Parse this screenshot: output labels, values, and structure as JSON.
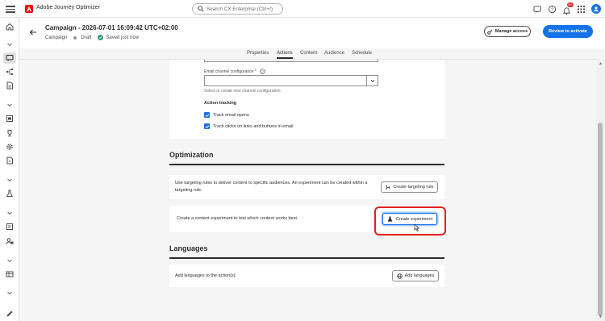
{
  "app": {
    "name": "Adobe Journey Optimizer"
  },
  "search": {
    "placeholder": "Search CX Enterprise (Ctrl+/)"
  },
  "notifications": {
    "count": "9+"
  },
  "header": {
    "title": "Campaign - 2026-07-01 16:09:42 UTC+02:00",
    "type": "Campaign",
    "status": "Draft",
    "saved": "Saved just now",
    "manage_access": "Manage access",
    "review": "Review to activate"
  },
  "tabs": [
    "Properties",
    "Actions",
    "Content",
    "Audience",
    "Schedule"
  ],
  "active_tab": "Actions",
  "email": {
    "channel_label": "Email channel configuration",
    "required_mark": "*",
    "help": "Select or create new channel configuration",
    "value": ""
  },
  "tracking": {
    "title": "Action tracking",
    "items": [
      "Track email opens",
      "Track clicks on links and buttons in email"
    ]
  },
  "optimization": {
    "title": "Optimization",
    "targeting_text": "Use targeting rules to deliver content to specific audiences. An experiment can be created within a targeting rule.",
    "targeting_button": "Create targeting rule",
    "experiment_text": "Create a content experiment to test which content works best.",
    "experiment_button": "Create experiment"
  },
  "languages": {
    "title": "Languages",
    "text": "Add languages to the action(s).",
    "button": "Add languages"
  },
  "icons": {
    "rail": [
      "home-icon",
      "chevron-down-icon",
      "campaign-icon",
      "journey-icon",
      "content-icon",
      "chevron-down-icon",
      "offers-icon",
      "trophy-icon",
      "settings-icon",
      "templates-icon",
      "chevron-down-icon",
      "experiment-icon",
      "chevron-down-icon",
      "reports-icon",
      "audience-icon",
      "chevron-down-icon",
      "data-icon",
      "chevron-down-icon",
      "edit-icon"
    ]
  },
  "colors": {
    "accent": "#1473e6",
    "highlight": "#e0211f",
    "success": "#2d9d78"
  }
}
